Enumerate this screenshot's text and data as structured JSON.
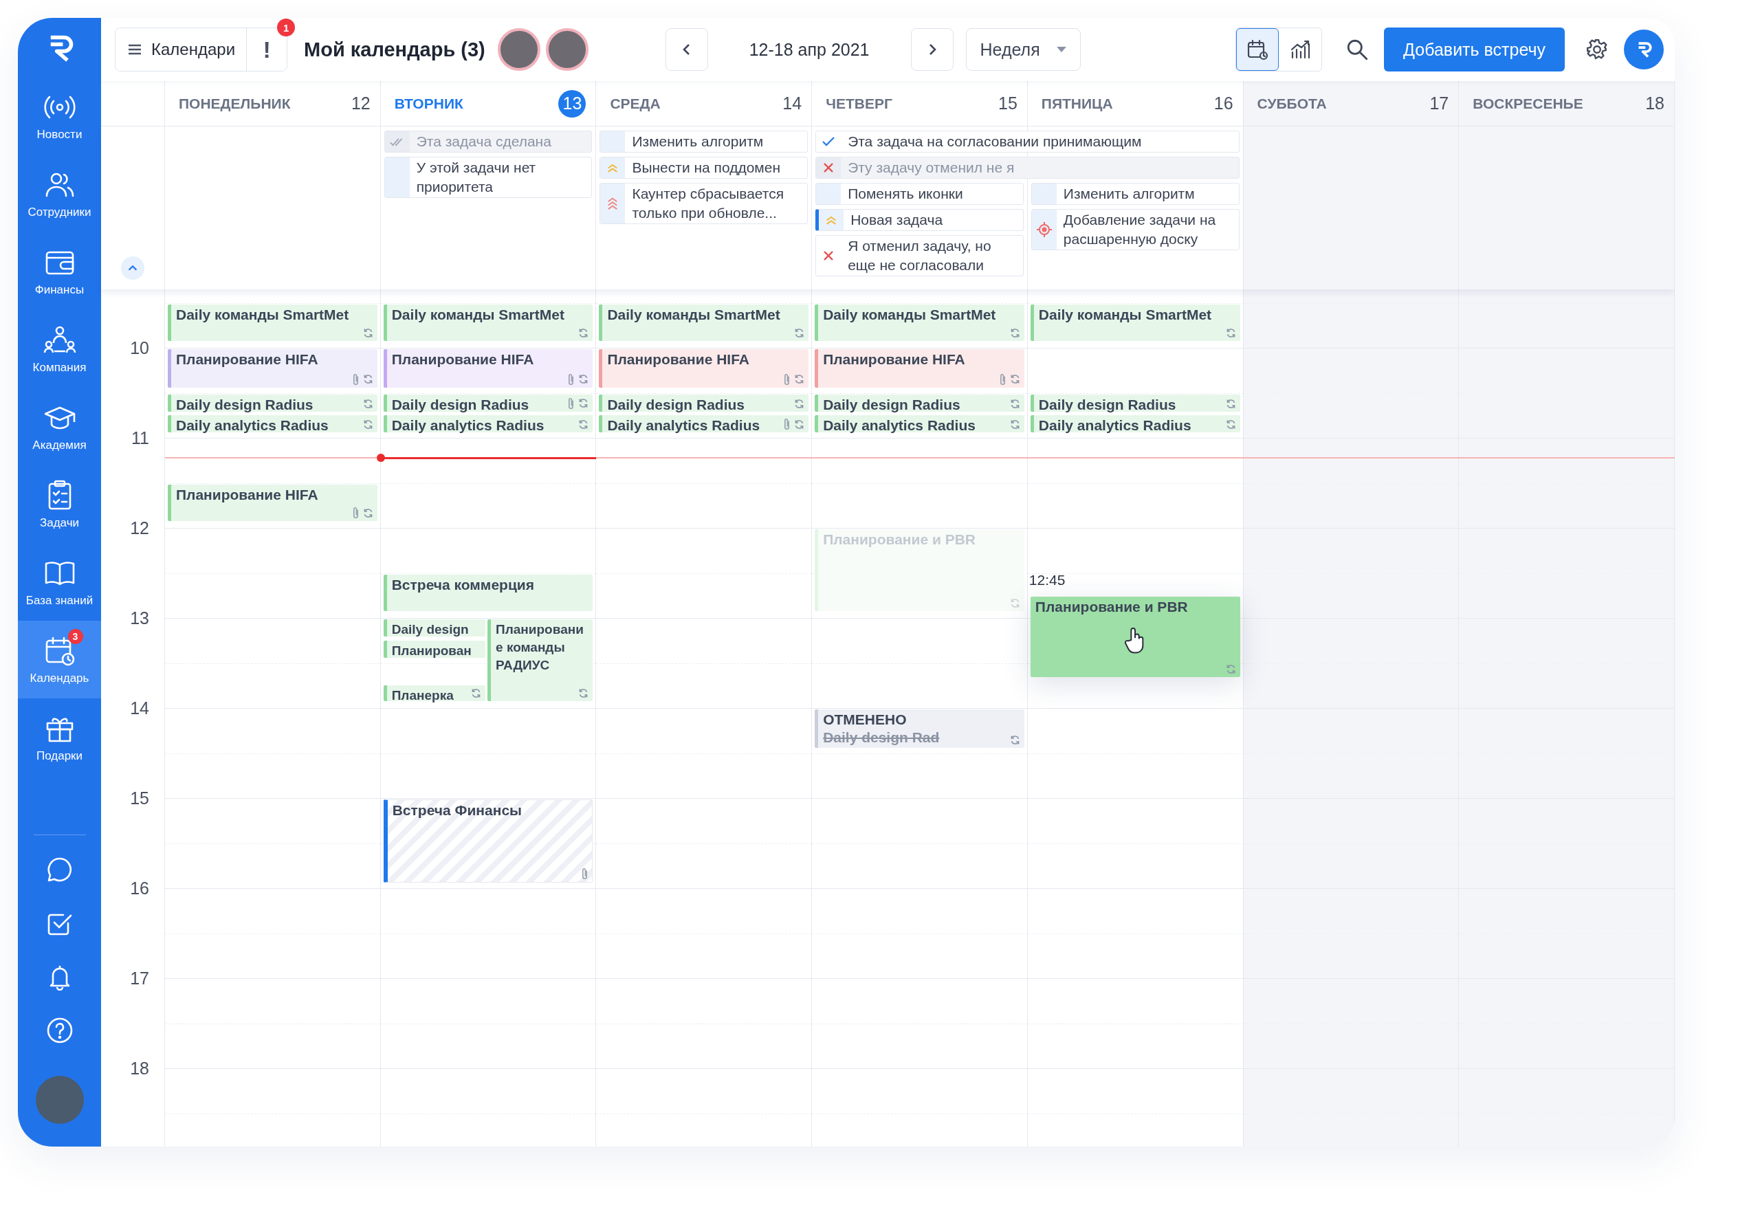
{
  "sidebar": {
    "items": [
      {
        "label": "Новости",
        "selected": false
      },
      {
        "label": "Сотрудники",
        "selected": false
      },
      {
        "label": "Финансы",
        "selected": false
      },
      {
        "label": "Компания",
        "selected": false
      },
      {
        "label": "Академия",
        "selected": false
      },
      {
        "label": "Задачи",
        "selected": false
      },
      {
        "label": "База знаний",
        "selected": false
      },
      {
        "label": "Календарь",
        "selected": true,
        "badge": "3"
      },
      {
        "label": "Подарки",
        "selected": false
      }
    ]
  },
  "topbar": {
    "calendars_button": "Календари",
    "alert": {
      "label": "!",
      "badge": "1"
    },
    "title": "Мой календарь (3)",
    "date_range": "12-18 апр 2021",
    "view_select": "Неделя",
    "views": [
      {
        "selected": true
      },
      {
        "selected": false
      }
    ],
    "add_button": "Добавить встречу"
  },
  "hours": [
    "10",
    "11",
    "12",
    "13",
    "14",
    "15",
    "16",
    "17",
    "18"
  ],
  "days": [
    {
      "name": "ПОНЕДЕЛЬНИК",
      "number": "12",
      "today": false,
      "weekend": false,
      "events": [
        {
          "title": "Daily команды SmartMet",
          "color": "#8fd89c",
          "kind": "normal",
          "attachment": false,
          "recurring": true
        },
        {
          "title": "Планирование HIFA",
          "color": "#b9b1ec",
          "kind": "normal",
          "attachment": true,
          "recurring": true
        },
        {
          "title": "Daily design Radius",
          "color": "#8fd89c",
          "kind": "normal",
          "attachment": false,
          "recurring": true
        },
        {
          "title": "Daily analytics Radius",
          "color": "#8fd89c",
          "kind": "normal",
          "attachment": false,
          "recurring": true
        },
        {
          "title": "Планирование HIFA",
          "color": "#8fd89c",
          "kind": "normal",
          "attachment": true,
          "recurring": true
        }
      ]
    },
    {
      "name": "ВТОРНИК",
      "number": "13",
      "today": true,
      "weekend": false,
      "tasks": [
        {
          "title": "Эта задача сделана",
          "kind": "done",
          "wide": false,
          "closed": true,
          "selected": false
        },
        {
          "title": "У этой задачи нет приоритета",
          "kind": "plain",
          "wide": false,
          "closed": false,
          "selected": false
        }
      ],
      "events": [
        {
          "title": "Daily команды SmartMet",
          "color": "#8fd89c",
          "kind": "normal",
          "attachment": false,
          "recurring": true
        },
        {
          "title": "Планирование HIFA",
          "color": "#c3a9f2",
          "kind": "normal",
          "attachment": true,
          "recurring": true
        },
        {
          "title": "Daily design Radius",
          "color": "#8fd89c",
          "kind": "normal",
          "attachment": true,
          "recurring": true
        },
        {
          "title": "Daily analytics Radius",
          "color": "#8fd89c",
          "kind": "normal",
          "attachment": false,
          "recurring": true
        },
        {
          "title": "Встреча коммерция",
          "color": "#8fd89c",
          "kind": "normal",
          "attachment": false,
          "recurring": false
        },
        {
          "kind": "group",
          "lanes": [
            {
              "events": [
                {
                  "title": "Daily design",
                  "color": "#8fd89c",
                  "attachment": false,
                  "recurring": false
                },
                {
                  "title": "Планирован",
                  "color": "#8fd89c",
                  "attachment": false,
                  "recurring": false
                },
                {
                  "title": "Планерка",
                  "color": "#8fd89c",
                  "attachment": false,
                  "recurring": true
                }
              ]
            },
            {
              "events": [
                {
                  "title": "Планирование команды РАДИУС",
                  "color": "#8fd89c",
                  "attachment": false,
                  "recurring": true
                }
              ]
            }
          ]
        },
        {
          "title": "Встреча Финансы",
          "color": "#1f7aec",
          "kind": "hatched",
          "attachment": true,
          "recurring": false
        }
      ]
    },
    {
      "name": "СРЕДА",
      "number": "14",
      "today": false,
      "weekend": false,
      "tasks": [
        {
          "title": "Изменить алгоритм",
          "kind": "plain",
          "wide": false,
          "closed": false,
          "selected": false
        },
        {
          "title": "Вынести на поддомен",
          "kind": "low",
          "wide": false,
          "closed": false,
          "selected": false
        },
        {
          "title": "Каунтер сбрасывается только при обновле...",
          "kind": "high",
          "wide": false,
          "closed": false,
          "selected": false
        }
      ],
      "events": [
        {
          "title": "Daily команды SmartMet",
          "color": "#8fd89c",
          "kind": "normal",
          "attachment": false,
          "recurring": true
        },
        {
          "title": "Планирование HIFA",
          "color": "#f2a0a0",
          "kind": "normal",
          "attachment": true,
          "recurring": true
        },
        {
          "title": "Daily design Radius",
          "color": "#8fd89c",
          "kind": "normal",
          "attachment": false,
          "recurring": true
        },
        {
          "title": "Daily analytics Radius",
          "color": "#8fd89c",
          "kind": "normal",
          "attachment": true,
          "recurring": true
        }
      ]
    },
    {
      "name": "ЧЕТВЕРГ",
      "number": "15",
      "today": false,
      "weekend": false,
      "tasks": [
        {
          "title": "Эта задача на согласовании принимающим",
          "kind": "approved",
          "wide": true,
          "closed": false,
          "selected": false
        },
        {
          "title": "Эту задачу отменил не я",
          "kind": "rejected",
          "wide": true,
          "closed": true,
          "selected": false
        },
        {
          "title": "Поменять иконки",
          "kind": "plain",
          "wide": false,
          "closed": false,
          "selected": false
        },
        {
          "title": "Новая задача",
          "kind": "low",
          "wide": false,
          "closed": false,
          "selected": true
        },
        {
          "title": "Я отменил задачу, но еще не согласовали",
          "kind": "rejected",
          "wide": false,
          "closed": false,
          "selected": false
        }
      ],
      "events": [
        {
          "title": "Daily команды SmartMet",
          "color": "#8fd89c",
          "kind": "normal",
          "attachment": false,
          "recurring": true
        },
        {
          "title": "Планирование HIFA",
          "color": "#f2a0a0",
          "kind": "normal",
          "attachment": true,
          "recurring": true
        },
        {
          "title": "Daily design Radius",
          "color": "#8fd89c",
          "kind": "normal",
          "attachment": false,
          "recurring": true
        },
        {
          "title": "Daily analytics Radius",
          "color": "#8fd89c",
          "kind": "normal",
          "attachment": false,
          "recurring": true
        },
        {
          "title": "Планирование и PBR",
          "color": "#e2f6e6",
          "kind": "ghost",
          "attachment": false,
          "recurring": true
        },
        {
          "status": "ОТМЕНЕНО",
          "title": "Daily design Rad",
          "color": "#c9cfdc",
          "kind": "cancelled",
          "attachment": false,
          "recurring": true
        }
      ]
    },
    {
      "name": "ПЯТНИЦА",
      "number": "16",
      "today": false,
      "weekend": false,
      "tasks": [
        {
          "title": "Изменить алгоритм",
          "kind": "plain",
          "wide": false,
          "closed": false,
          "selected": false
        },
        {
          "title": "Добавление задачи на расшаренную доску",
          "kind": "target",
          "wide": false,
          "closed": false,
          "selected": false
        }
      ],
      "events": [
        {
          "title": "Daily команды SmartMet",
          "color": "#8fd89c",
          "kind": "normal",
          "attachment": false,
          "recurring": true
        },
        {
          "title": "Daily design Radius",
          "color": "#8fd89c",
          "kind": "normal",
          "attachment": false,
          "recurring": true
        },
        {
          "title": "Daily analytics Radius",
          "color": "#8fd89c",
          "kind": "normal",
          "attachment": false,
          "recurring": true
        },
        {
          "title": "Планирование и PBR",
          "time_label": "12:45",
          "color": "#9ddfa6",
          "kind": "dragging",
          "attachment": false,
          "recurring": true
        }
      ]
    },
    {
      "name": "СУББОТА",
      "number": "17",
      "today": false,
      "weekend": true
    },
    {
      "name": "ВОСКРЕСЕНЬЕ",
      "number": "18",
      "today": false,
      "weekend": true
    }
  ]
}
